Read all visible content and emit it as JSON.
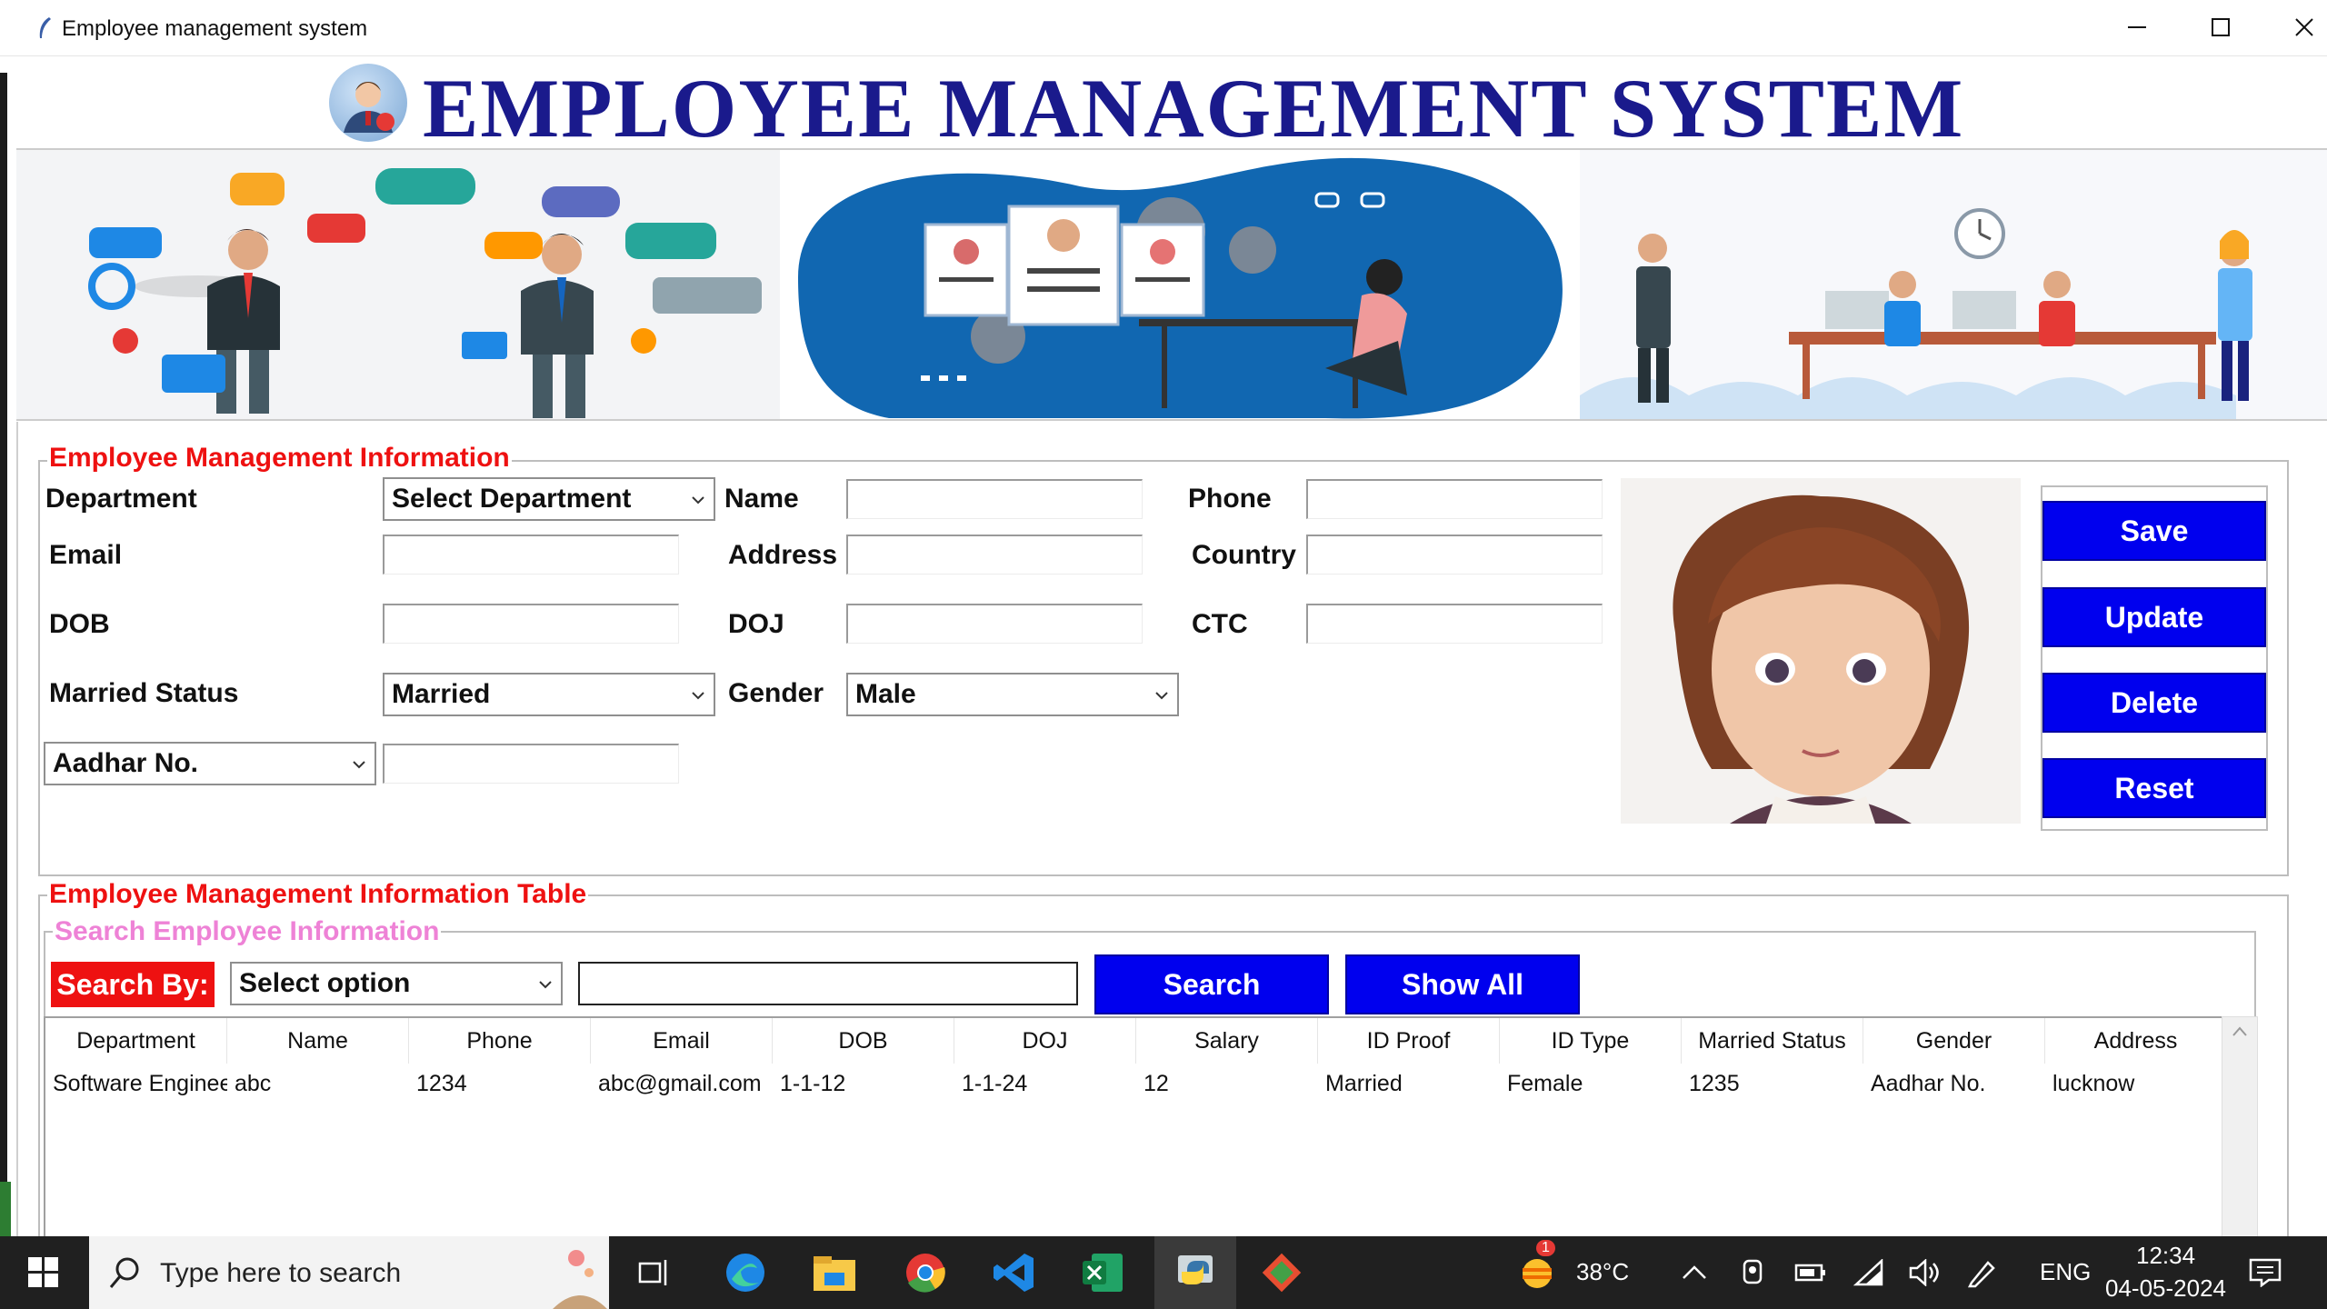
{
  "window": {
    "title": "Employee management system"
  },
  "header": {
    "title": "EMPLOYEE MANAGEMENT SYSTEM"
  },
  "info": {
    "legend": "Employee Management Information",
    "department_label": "Department",
    "department_value": "Select Department",
    "name_label": "Name",
    "phone_label": "Phone",
    "email_label": "Email",
    "address_label": "Address",
    "country_label": "Country",
    "dob_label": "DOB",
    "doj_label": "DOJ",
    "ctc_label": "CTC",
    "married_label": "Married Status",
    "married_value": "Married",
    "gender_label": "Gender",
    "gender_value": "Male",
    "idtype_value": "Aadhar No."
  },
  "buttons": {
    "save": "Save",
    "update": "Update",
    "delete": "Delete",
    "reset": "Reset"
  },
  "table_section": {
    "legend": "Employee Management Information Table",
    "search_legend": "Search Employee Information",
    "search_by_label": "Search By:",
    "search_option": "Select option",
    "search_button": "Search",
    "show_all_button": "Show All"
  },
  "table": {
    "columns": [
      "Department",
      "Name",
      "Phone",
      "Email",
      "DOB",
      "DOJ",
      "Salary",
      "ID Proof",
      "ID Type",
      "Married Status",
      "Gender",
      "Address"
    ],
    "rows": [
      [
        "Software Enginee",
        "abc",
        "1234",
        "abc@gmail.com",
        "1-1-12",
        "1-1-24",
        "12",
        "Married",
        "Female",
        "1235",
        "Aadhar No.",
        "lucknow"
      ]
    ]
  },
  "taskbar": {
    "search_placeholder": "Type here to search",
    "weather": "38°C",
    "notification_count": "1",
    "language": "ENG",
    "time": "12:34",
    "date": "04-05-2024"
  }
}
